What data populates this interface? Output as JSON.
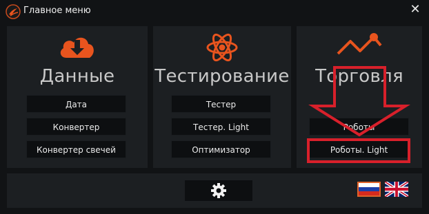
{
  "window": {
    "title": "Главное меню",
    "close_glyph": "✕"
  },
  "colors": {
    "accent": "#e8541e",
    "highlight_red": "#d8202b",
    "panel_bg": "#1c1f22",
    "button_bg": "#0d0f11"
  },
  "sections": {
    "data": {
      "icon": "cloud-download-icon",
      "title": "Данные",
      "buttons": [
        "Дата",
        "Конвертер",
        "Конвертер свечей"
      ]
    },
    "testing": {
      "icon": "atom-icon",
      "title": "Тестирование",
      "buttons": [
        "Тестер",
        "Тестер. Light",
        "Оптимизатор"
      ]
    },
    "trading": {
      "icon": "trend-line-icon",
      "title": "Торговля",
      "buttons": [
        "Роботы",
        "Роботы. Light"
      ]
    }
  },
  "bottom": {
    "settings_icon": "gear-icon",
    "languages": [
      {
        "code": "ru",
        "icon": "russia-flag-icon",
        "selected": true
      },
      {
        "code": "en",
        "icon": "uk-flag-icon",
        "selected": false
      }
    ]
  }
}
